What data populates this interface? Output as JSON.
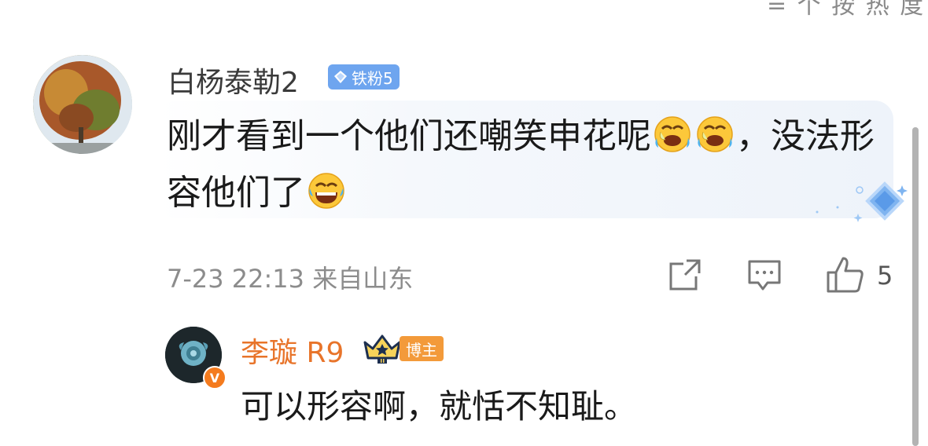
{
  "top_partial_text": "= 个 按 热 度",
  "comment": {
    "username": "白杨泰勒2",
    "fan_badge": "铁粉5",
    "text_part1": "刚才看到一个他们还嘲笑申花呢",
    "text_part2": "，没法形容他们了",
    "emoji_names": [
      "crying-laughing-emoji",
      "crying-laughing-emoji",
      "laughing-emoji"
    ],
    "time_location": "7-23 22:13 来自山东",
    "like_count": "5"
  },
  "reply": {
    "username": "李璇 R9",
    "verified_badge": "V",
    "role_badge": "博主",
    "text": "可以形容啊，就恬不知耻。"
  },
  "colors": {
    "fan_badge": "#6ea5ef",
    "reply_username": "#e8742a",
    "blogger_badge": "#f39a3a",
    "meta_text": "#8c8c8c"
  }
}
